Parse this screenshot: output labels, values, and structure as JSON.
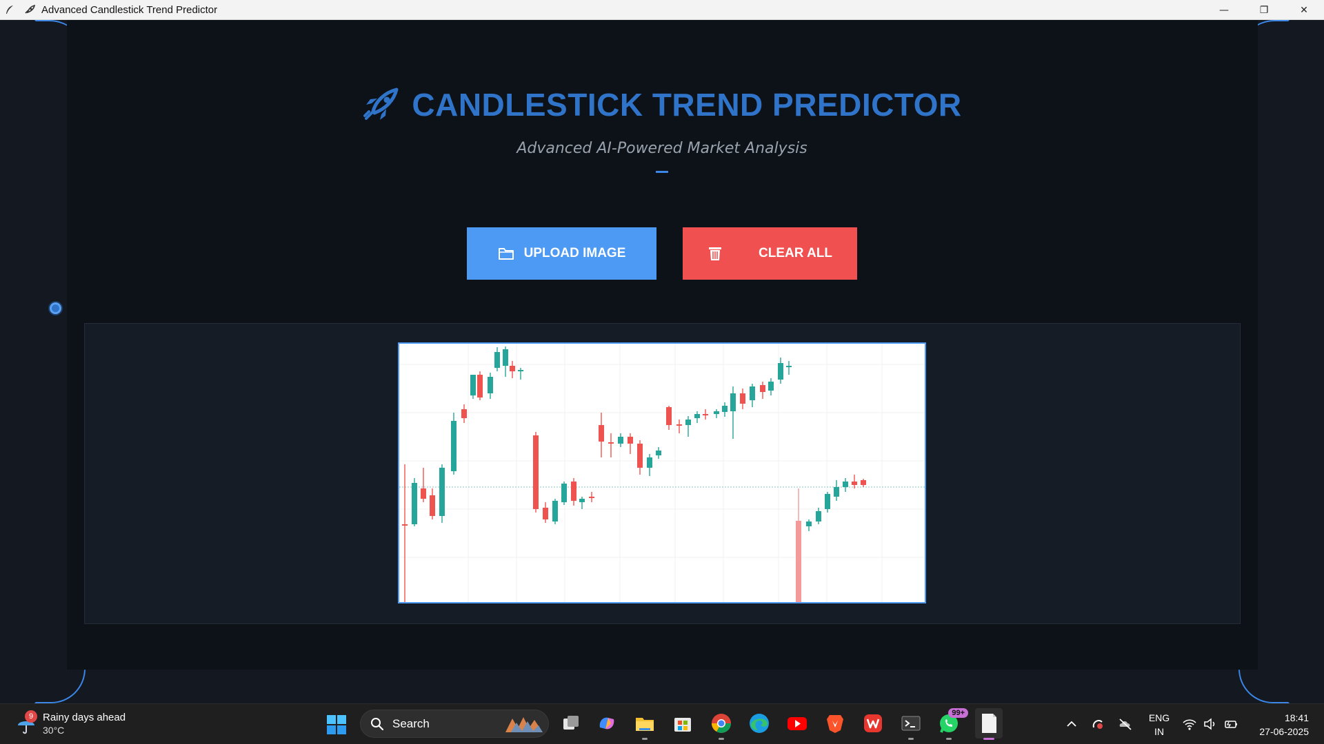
{
  "window": {
    "title": "Advanced Candlestick Trend Predictor",
    "controls": {
      "minimize": "—",
      "restore": "❐",
      "close": "✕"
    }
  },
  "header": {
    "title": "CANDLESTICK TREND PREDICTOR",
    "subtitle": "Advanced AI-Powered Market Analysis",
    "icon": "rocket-icon"
  },
  "buttons": {
    "upload_label": "UPLOAD IMAGE",
    "upload_icon": "folder-icon",
    "clear_label": "CLEAR ALL",
    "clear_icon": "trash-icon"
  },
  "colors": {
    "accent": "#2f74c9",
    "upload": "#4d9af4",
    "clear": "#f05050",
    "bull": "#26a69a",
    "bear": "#ef5350"
  },
  "taskbar": {
    "weather": {
      "text": "Rainy days ahead",
      "temp": "30°C",
      "badge": "9"
    },
    "search_placeholder": "Search",
    "whatsapp_badge": "99+",
    "language": {
      "line1": "ENG",
      "line2": "IN"
    },
    "clock": {
      "time": "18:41",
      "date": "27-06-2025"
    }
  }
}
